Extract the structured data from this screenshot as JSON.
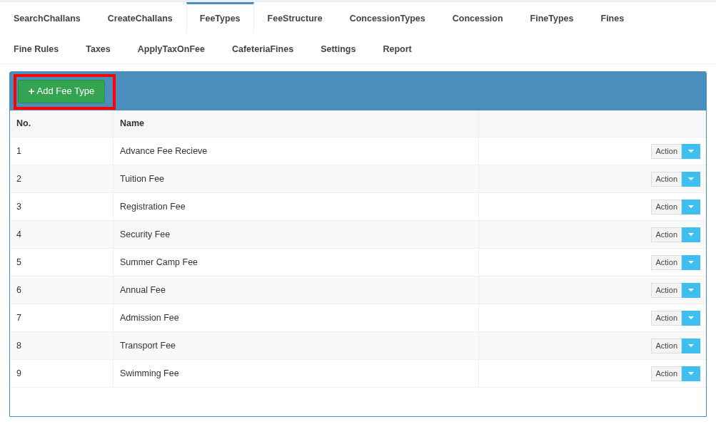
{
  "tabs": [
    {
      "label": "SearchChallans",
      "selected": false
    },
    {
      "label": "CreateChallans",
      "selected": false
    },
    {
      "label": "FeeTypes",
      "selected": true
    },
    {
      "label": "FeeStructure",
      "selected": false
    },
    {
      "label": "ConcessionTypes",
      "selected": false
    },
    {
      "label": "Concession",
      "selected": false
    },
    {
      "label": "FineTypes",
      "selected": false
    },
    {
      "label": "Fines",
      "selected": false
    },
    {
      "label": "Fine Rules",
      "selected": false
    },
    {
      "label": "Taxes",
      "selected": false
    },
    {
      "label": "ApplyTaxOnFee",
      "selected": false
    },
    {
      "label": "CafeteriaFines",
      "selected": false
    },
    {
      "label": "Settings",
      "selected": false
    },
    {
      "label": "Report",
      "selected": false
    }
  ],
  "add_button": {
    "icon": "+",
    "label": "Add Fee Type"
  },
  "table": {
    "columns": [
      "No.",
      "Name"
    ],
    "rows": [
      {
        "no": "1",
        "name": "Advance Fee Recieve",
        "action": "Action"
      },
      {
        "no": "2",
        "name": "Tuition Fee",
        "action": "Action"
      },
      {
        "no": "3",
        "name": "Registration Fee",
        "action": "Action"
      },
      {
        "no": "4",
        "name": "Security Fee",
        "action": "Action"
      },
      {
        "no": "5",
        "name": "Summer Camp Fee",
        "action": "Action"
      },
      {
        "no": "6",
        "name": "Annual Fee",
        "action": "Action"
      },
      {
        "no": "7",
        "name": "Admission Fee",
        "action": "Action"
      },
      {
        "no": "8",
        "name": "Transport Fee",
        "action": "Action"
      },
      {
        "no": "9",
        "name": "Swimming Fee",
        "action": "Action"
      }
    ]
  }
}
